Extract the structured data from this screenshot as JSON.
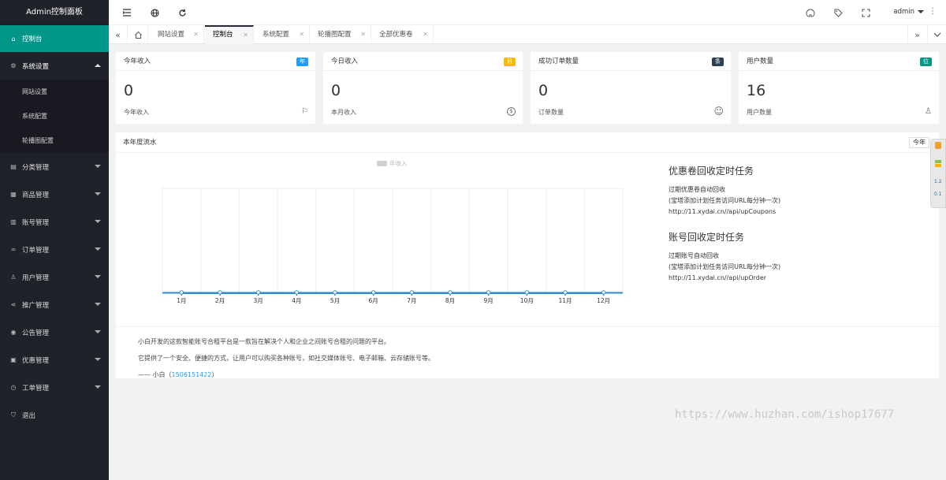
{
  "app": {
    "title": "Admin控制面板"
  },
  "sidebar": {
    "items": [
      {
        "label": "控制台",
        "icon": "home-icon",
        "glyph": "⌂"
      },
      {
        "label": "系统设置",
        "icon": "gear-icon",
        "glyph": "⚙"
      },
      {
        "label": "分类管理",
        "icon": "category-icon",
        "glyph": "▤"
      },
      {
        "label": "商品管理",
        "icon": "goods-icon",
        "glyph": "▦"
      },
      {
        "label": "账号管理",
        "icon": "account-icon",
        "glyph": "▥"
      },
      {
        "label": "订单管理",
        "icon": "link-icon",
        "glyph": "∞"
      },
      {
        "label": "用户管理",
        "icon": "user-icon",
        "glyph": "♙"
      },
      {
        "label": "推广管理",
        "icon": "share-icon",
        "glyph": "⋖"
      },
      {
        "label": "公告管理",
        "icon": "notice-icon",
        "glyph": "◉"
      },
      {
        "label": "优惠管理",
        "icon": "calendar-icon",
        "glyph": "▣"
      },
      {
        "label": "工单管理",
        "icon": "clock-icon",
        "glyph": "◷"
      },
      {
        "label": "退出",
        "icon": "shield-icon",
        "glyph": "⛉"
      }
    ],
    "sub_items": [
      "网站设置",
      "系统配置",
      "轮播图配置"
    ]
  },
  "header": {
    "user": "admin"
  },
  "tabs": [
    "网站设置",
    "控制台",
    "系统配置",
    "轮播图配置",
    "全部优惠卷"
  ],
  "cards": [
    {
      "title": "今年收入",
      "badge": "年",
      "badge_color": "#1e9fff",
      "value": "0",
      "foot": "今年收入",
      "icon": "flag-icon",
      "glyph": "⚐"
    },
    {
      "title": "今日收入",
      "badge": "月",
      "badge_color": "#ffb800",
      "value": "0",
      "foot": "本月收入",
      "icon": "dollar-icon",
      "glyph": "$"
    },
    {
      "title": "成功订单数量",
      "badge": "条",
      "badge_color": "#2f4056",
      "value": "0",
      "foot": "订单数量",
      "icon": "smile-icon",
      "glyph": "☺"
    },
    {
      "title": "用户数量",
      "badge": "位",
      "badge_color": "#009688",
      "value": "16",
      "foot": "用户数量",
      "icon": "users-icon",
      "glyph": "♙"
    }
  ],
  "panel": {
    "title": "本年度流水",
    "select": "今年"
  },
  "chart_data": {
    "type": "line",
    "categories": [
      "1月",
      "2月",
      "3月",
      "4月",
      "5月",
      "6月",
      "7月",
      "8月",
      "9月",
      "10月",
      "11月",
      "12月"
    ],
    "series": [
      {
        "name": "年收入",
        "values": [
          0,
          0,
          0,
          0,
          0,
          0,
          0,
          0,
          0,
          0,
          0,
          0
        ]
      }
    ],
    "color": "#2d8cc8",
    "ylim": [
      0,
      1
    ],
    "grid": "vertical",
    "legend": "top-center"
  },
  "tasks": [
    {
      "title": "优惠卷回收定时任务",
      "lines": [
        "过期优惠卷自动回收",
        "(宝塔添加计划任务访问URL每分钟一次)",
        "http://11.xydai.cn//api/upCoupons"
      ]
    },
    {
      "title": "账号回收定时任务",
      "lines": [
        "过期账号自动回收",
        "(宝塔添加计划任务访问URL每分钟一次)",
        "http://11.xydai.cn//api/upOrder"
      ]
    }
  ],
  "about": {
    "line1": "小白开发的这款智能账号合租平台是一款旨在解决个人和企业之间账号合租的问题的平台。",
    "line2": "它提供了一个安全、便捷的方式，让用户可以购买各种账号，如社交媒体账号、电子邮箱、云存储账号等。",
    "sign_prefix": "—— 小白（",
    "sign_link": "1506151422",
    "sign_suffix": "）"
  },
  "float_tool": {
    "v1": "1.2",
    "v2": "0.1"
  },
  "watermark": "https://www.huzhan.com/ishop17677"
}
